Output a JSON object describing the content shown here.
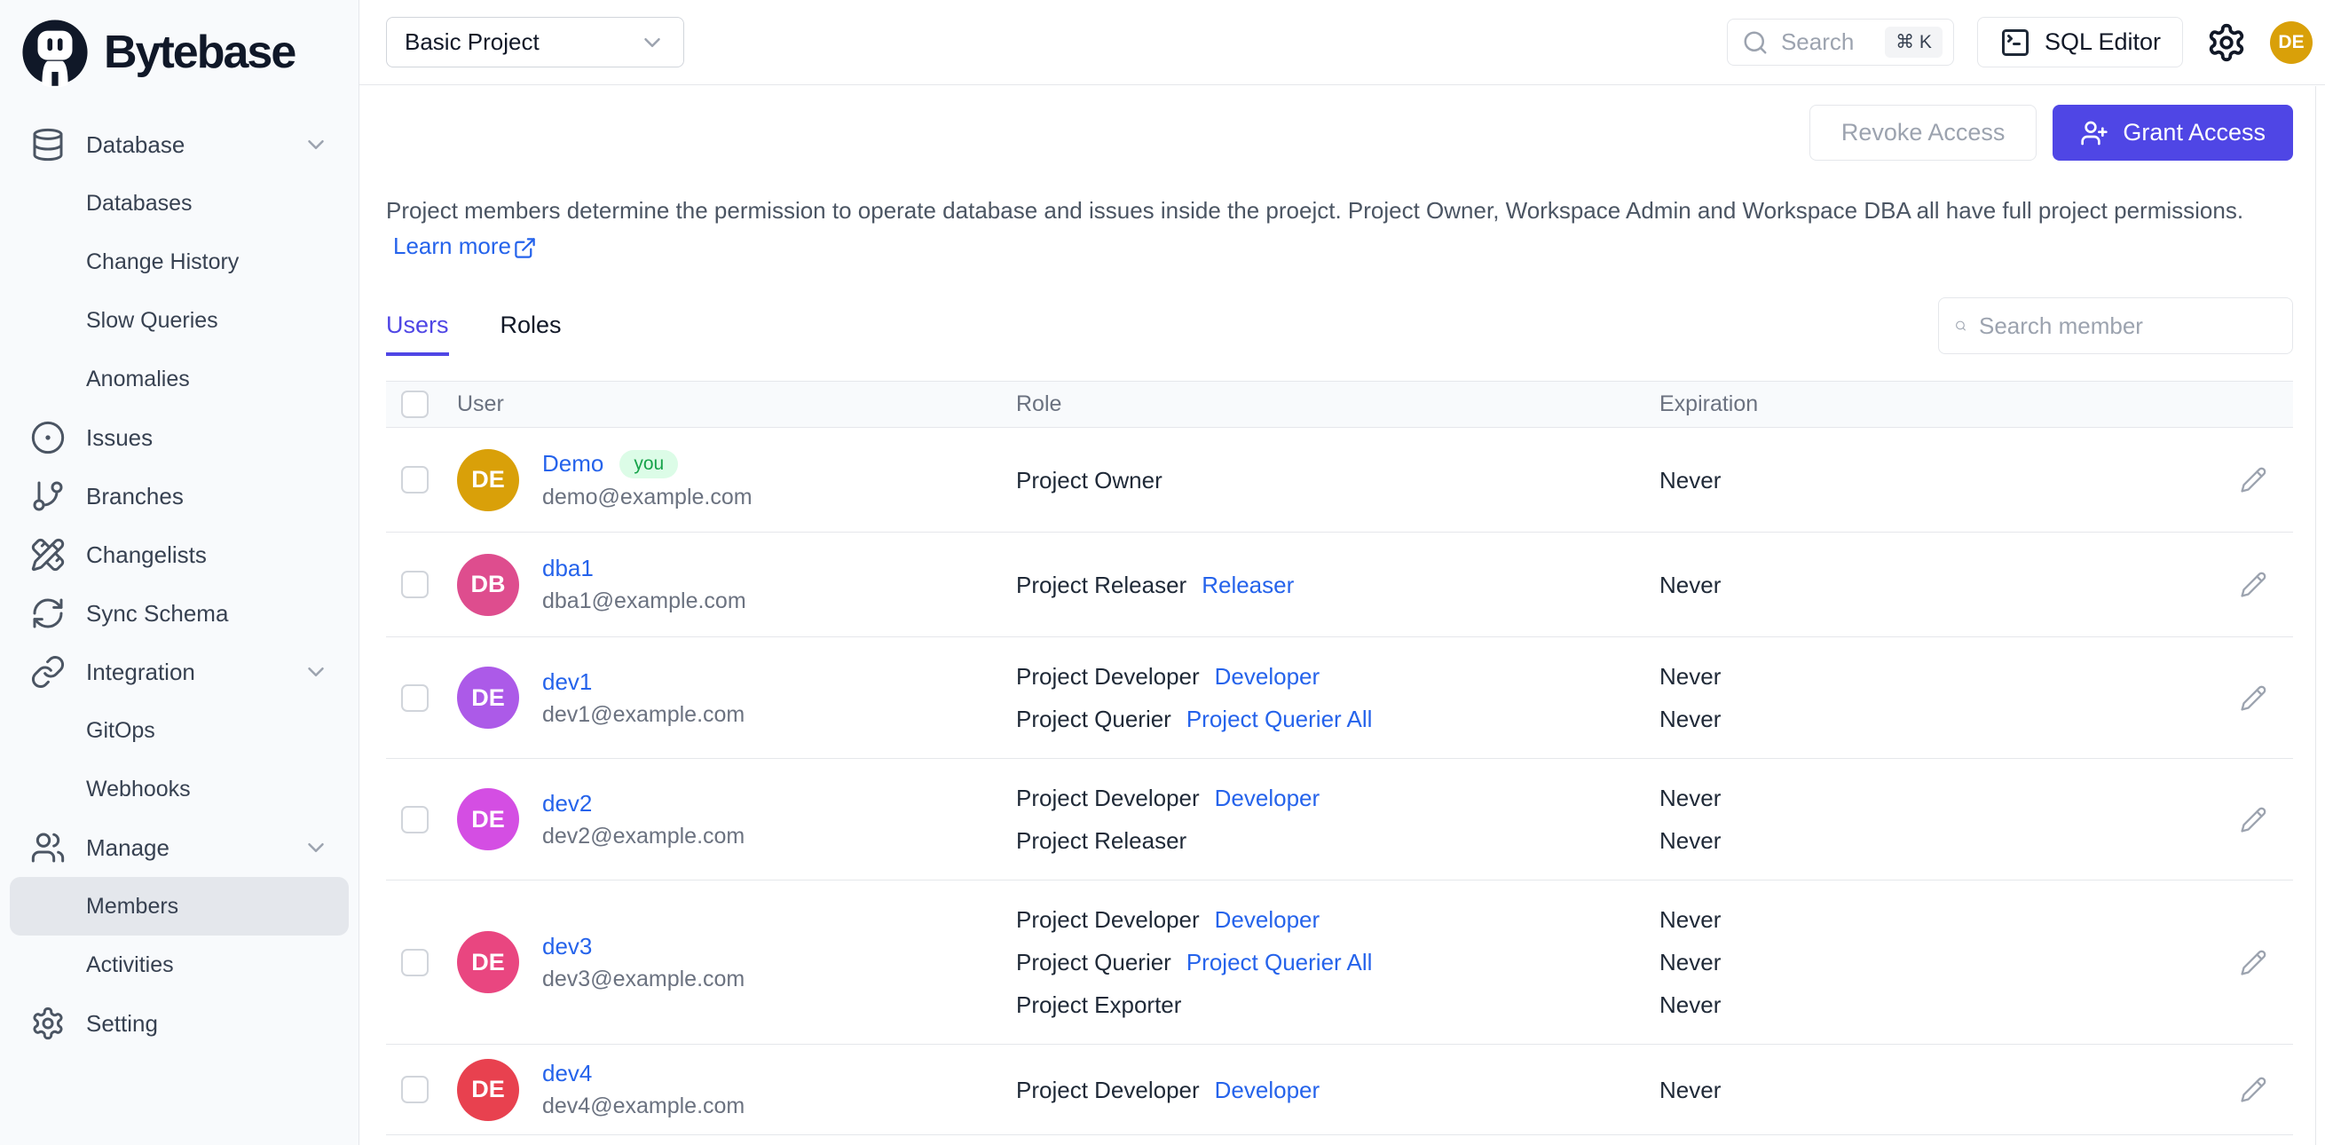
{
  "brand": {
    "name": "Bytebase"
  },
  "topbar": {
    "project_selector": {
      "value": "Basic Project"
    },
    "search": {
      "placeholder": "Search",
      "shortcut": "⌘ K"
    },
    "sql_editor_label": "SQL Editor",
    "avatar_initials": "DE",
    "avatar_color": "#D9A009"
  },
  "sidebar": {
    "items": [
      {
        "label": "Database",
        "type": "group",
        "icon": "database-icon",
        "expanded": true
      },
      {
        "label": "Databases",
        "type": "sub"
      },
      {
        "label": "Change History",
        "type": "sub"
      },
      {
        "label": "Slow Queries",
        "type": "sub"
      },
      {
        "label": "Anomalies",
        "type": "sub"
      },
      {
        "label": "Issues",
        "type": "item",
        "icon": "circle-dot-icon"
      },
      {
        "label": "Branches",
        "type": "item",
        "icon": "git-branch-icon"
      },
      {
        "label": "Changelists",
        "type": "item",
        "icon": "pencil-ruler-icon"
      },
      {
        "label": "Sync Schema",
        "type": "item",
        "icon": "refresh-icon"
      },
      {
        "label": "Integration",
        "type": "group",
        "icon": "link-icon",
        "expanded": true
      },
      {
        "label": "GitOps",
        "type": "sub"
      },
      {
        "label": "Webhooks",
        "type": "sub"
      },
      {
        "label": "Manage",
        "type": "group",
        "icon": "users-icon",
        "expanded": true
      },
      {
        "label": "Members",
        "type": "sub",
        "active": true
      },
      {
        "label": "Activities",
        "type": "sub"
      },
      {
        "label": "Setting",
        "type": "item",
        "icon": "gear-icon"
      }
    ]
  },
  "page": {
    "actions": {
      "revoke_label": "Revoke Access",
      "grant_label": "Grant Access"
    },
    "description": "Project members determine the permission to operate database and issues inside the proejct. Project Owner, Workspace Admin and Workspace DBA all have full project permissions.",
    "learn_more_label": "Learn more",
    "tabs": [
      {
        "label": "Users",
        "active": true
      },
      {
        "label": "Roles",
        "active": false
      }
    ],
    "member_search_placeholder": "Search member",
    "table": {
      "headers": [
        "User",
        "Role",
        "Expiration"
      ],
      "rows": [
        {
          "initials": "DE",
          "avatar_color": "#D9A009",
          "name": "Demo",
          "you_badge": "you",
          "email": "demo@example.com",
          "roles": [
            {
              "role": "Project Owner",
              "link": "",
              "expiration": "Never"
            }
          ]
        },
        {
          "initials": "DB",
          "avatar_color": "#DE4D8E",
          "name": "dba1",
          "email": "dba1@example.com",
          "roles": [
            {
              "role": "Project Releaser",
              "link": "Releaser",
              "expiration": "Never"
            }
          ]
        },
        {
          "initials": "DE",
          "avatar_color": "#AC5AE8",
          "name": "dev1",
          "email": "dev1@example.com",
          "roles": [
            {
              "role": "Project Developer",
              "link": "Developer",
              "expiration": "Never"
            },
            {
              "role": "Project Querier",
              "link": "Project Querier All",
              "expiration": "Never"
            }
          ]
        },
        {
          "initials": "DE",
          "avatar_color": "#D44EE3",
          "name": "dev2",
          "email": "dev2@example.com",
          "roles": [
            {
              "role": "Project Developer",
              "link": "Developer",
              "expiration": "Never"
            },
            {
              "role": "Project Releaser",
              "link": "",
              "expiration": "Never"
            }
          ]
        },
        {
          "initials": "DE",
          "avatar_color": "#E94680",
          "name": "dev3",
          "email": "dev3@example.com",
          "roles": [
            {
              "role": "Project Developer",
              "link": "Developer",
              "expiration": "Never"
            },
            {
              "role": "Project Querier",
              "link": "Project Querier All",
              "expiration": "Never"
            },
            {
              "role": "Project Exporter",
              "link": "",
              "expiration": "Never"
            }
          ]
        },
        {
          "initials": "DE",
          "avatar_color": "#E8414F",
          "name": "dev4",
          "email": "dev4@example.com",
          "roles": [
            {
              "role": "Project Developer",
              "link": "Developer",
              "expiration": "Never"
            }
          ]
        }
      ]
    }
  },
  "colors": {
    "accent": "#4F46E5",
    "link": "#2563EB",
    "badge_bg": "#DCFCE7",
    "badge_text": "#16A34A"
  }
}
